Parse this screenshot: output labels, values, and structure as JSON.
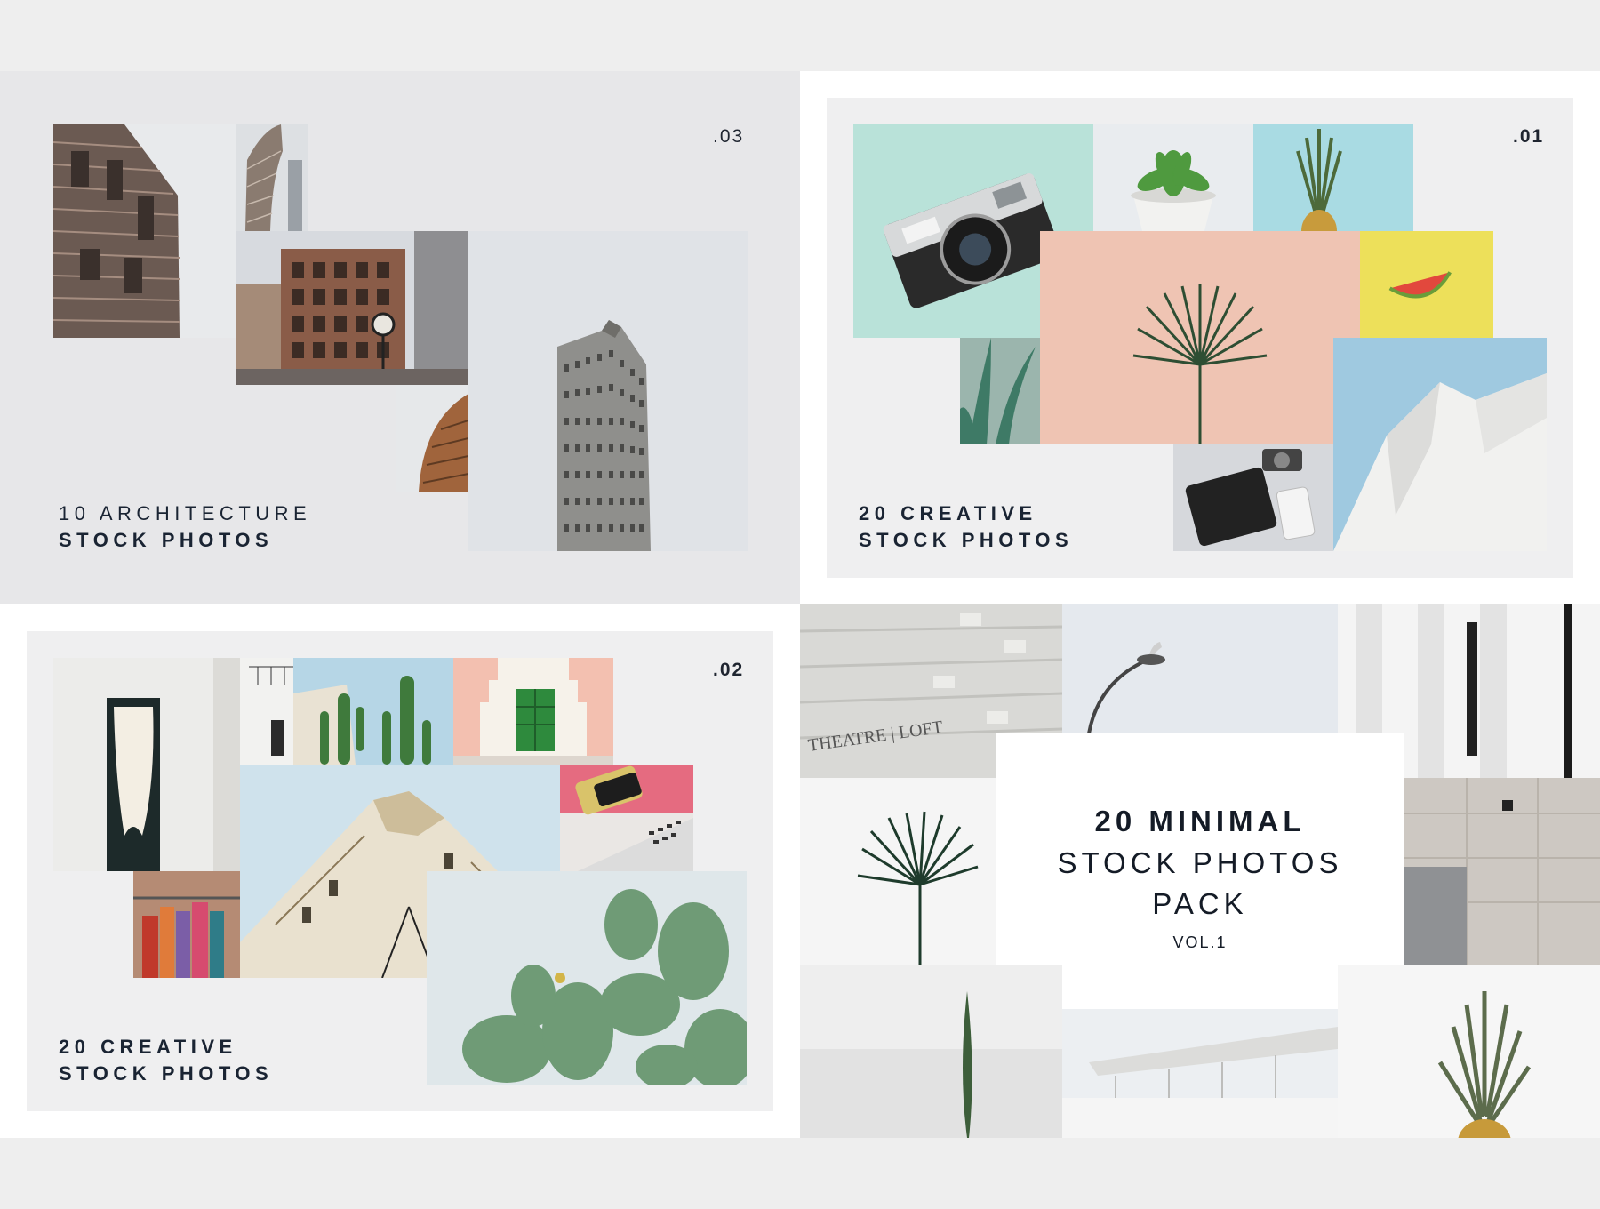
{
  "panels": {
    "architecture": {
      "number": ".03",
      "caption_line1": "10 ARCHITECTURE",
      "caption_line2": "STOCK PHOTOS"
    },
    "creative_1": {
      "number": ".01",
      "caption_line1": "20 CREATIVE",
      "caption_line2": "STOCK PHOTOS"
    },
    "creative_2": {
      "number": ".02",
      "caption_line1": "20 CREATIVE",
      "caption_line2": "STOCK PHOTOS"
    },
    "minimal": {
      "title_line1": "20 MINIMAL",
      "title_line2": "STOCK PHOTOS",
      "title_line3": "PACK",
      "title_line4": "VOL.1",
      "sign_text": "THEATRE | LOFT"
    }
  },
  "colors": {
    "page_bg": "#eeeeee",
    "panel_gray": "#e7e7e9",
    "panel_white": "#ffffff",
    "text_dark": "#1a2433"
  }
}
